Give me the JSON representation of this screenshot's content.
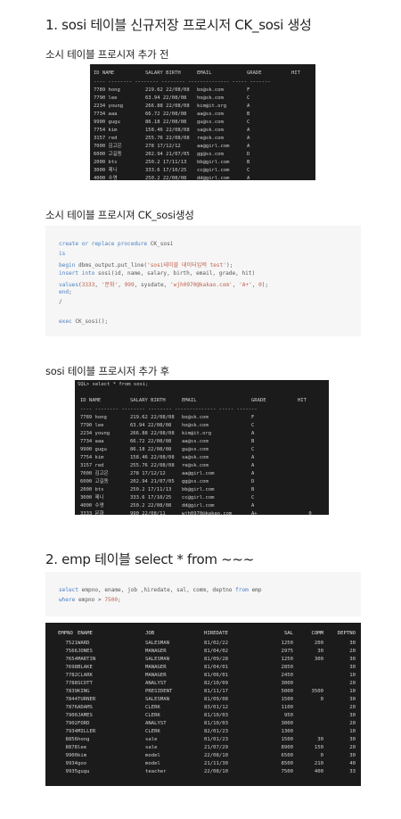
{
  "section1": {
    "title": "1. sosi 테이블 신규저장 프로시저 CK_sosi 생성",
    "before_label": "소시 테이블 프로시져 추가 전",
    "create_label": "소시 테이블 프로시져 CK_sosi생성",
    "after_label": "sosi 테이블 프로시저 추가 후",
    "after_prompt": "SQL> select * from sosi;"
  },
  "sosi_header": [
    "ID NAME",
    "SALARY BIRTH",
    "EMAIL",
    "GRADE",
    "HIT"
  ],
  "sosi_separator": "---- -------- -------- -------- -------------- ----- -------",
  "sosi_rows": [
    [
      "7789 hong",
      "219.62 22/08/08",
      "bo@sk.com",
      "F"
    ],
    [
      "7790 lee",
      "63.94 22/08/08",
      "ho@sk.com",
      "C"
    ],
    [
      "2234 young",
      "266.88 22/08/08",
      "kim@it.org",
      "A"
    ],
    [
      "7734 aaa",
      "66.72 22/08/08",
      "aa@ss.com",
      "B"
    ],
    [
      "9900 gugu",
      "86.18 22/08/08",
      "gu@ss.com",
      "C"
    ],
    [
      "7754 kim",
      "158.46 22/08/08",
      "sa@sk.com",
      "A"
    ],
    [
      "3157 red",
      "255.76 22/08/08",
      "re@sk.com",
      "A"
    ],
    [
      "7000 김고은",
      "278 17/12/12",
      "aa@girl.com",
      "A"
    ],
    [
      "6000 고길동",
      "202.94 21/07/05",
      "gg@ss.com",
      "D"
    ],
    [
      "2000 bts",
      "250.2 17/11/13",
      "bb@girl.com",
      "B"
    ],
    [
      "3000 제니",
      "333.6 17/10/25",
      "cc@girl.com",
      "C"
    ],
    [
      "4000 수영",
      "250.2 22/08/08",
      "dd@girl.com",
      "A"
    ]
  ],
  "sosi_new_row": [
    "3333 문화",
    "990 22/08/11",
    "wjh0970@kakao.com",
    "A+",
    "0"
  ],
  "procedure_code": {
    "line1": {
      "kw": "create or replace procedure",
      "rest": " CK_sosi"
    },
    "line2": {
      "kw": "is"
    },
    "line3": {
      "kw": "begin",
      "mid": " dbms_output.put_line(",
      "str": "'sosi테이블 데이터입력 test'",
      "end": ");"
    },
    "line4": {
      "kw": "insert into",
      "rest": " sosi(id, name, salary, birth, email, grade, hit)"
    },
    "line5": {
      "kw": "values",
      "a": "(",
      "n1": "3333",
      "b": ", ",
      "s1": "'문화'",
      "c": ", ",
      "n2": "999",
      "d": ", sysdate, ",
      "s2": "'wjh0970@kakao.com'",
      "e": ", ",
      "s3": "'A+'",
      "f": ", ",
      "n3": "0",
      "g": ");"
    },
    "line6": {
      "kw": "end",
      "rest": ";"
    },
    "line7": {
      "rest": "/"
    },
    "line9": {
      "kw": "exec",
      "rest": " CK_sosi();"
    }
  },
  "section2": {
    "title": "2. emp 테이블 select * from ~~~",
    "query_line1": {
      "kw1": "select",
      "rest1": " empno, ename, job ,hiredate, sal, comm, deptno ",
      "kw2": "from",
      "rest2": " emp"
    },
    "query_line2": {
      "kw": "where",
      "rest": " empno > ",
      "num": "7500",
      "end": ";"
    }
  },
  "emp_header": [
    "EMPNO",
    "ENAME",
    "JOB",
    "HIREDATE",
    "SAL",
    "COMM",
    "DEPTNO"
  ],
  "emp_rows": [
    [
      "7521",
      "WARD",
      "SALESMAN",
      "81/02/22",
      "1250",
      "200",
      "30"
    ],
    [
      "7566",
      "JONES",
      "MANAGER",
      "81/04/02",
      "2975",
      "30",
      "20"
    ],
    [
      "7654",
      "MARTIN",
      "SALESMAN",
      "81/09/28",
      "1250",
      "300",
      "30"
    ],
    [
      "7698",
      "BLAKE",
      "MANAGER",
      "81/04/01",
      "2850",
      "",
      "30"
    ],
    [
      "7782",
      "CLARK",
      "MANAGER",
      "81/06/01",
      "2450",
      "",
      "10"
    ],
    [
      "7788",
      "SCOTT",
      "ANALYST",
      "82/10/09",
      "3000",
      "",
      "20"
    ],
    [
      "7839",
      "KING",
      "PRESIDENT",
      "81/11/17",
      "5000",
      "3500",
      "10"
    ],
    [
      "7844",
      "TURNER",
      "SALESMAN",
      "81/09/08",
      "1500",
      "0",
      "30"
    ],
    [
      "7876",
      "ADAMS",
      "CLERK",
      "83/01/12",
      "1100",
      "",
      "20"
    ],
    [
      "7900",
      "JAMES",
      "CLERK",
      "81/10/03",
      "950",
      "",
      "30"
    ],
    [
      "7902",
      "FORD",
      "ANALYST",
      "81/10/03",
      "3000",
      "",
      "20"
    ],
    [
      "7934",
      "MILLER",
      "CLERK",
      "82/01/23",
      "1300",
      "",
      "10"
    ],
    [
      "8856",
      "hong",
      "sale",
      "01/01/23",
      "1500",
      "30",
      "30"
    ],
    [
      "8878",
      "lee",
      "sale",
      "21/07/29",
      "8900",
      "150",
      "20"
    ],
    [
      "9900",
      "kim",
      "model",
      "22/08/10",
      "6500",
      "0",
      "30"
    ],
    [
      "9934",
      "goo",
      "model",
      "21/11/30",
      "8500",
      "210",
      "40"
    ],
    [
      "9935",
      "gugu",
      "teacher",
      "22/08/10",
      "7500",
      "400",
      "33"
    ]
  ]
}
